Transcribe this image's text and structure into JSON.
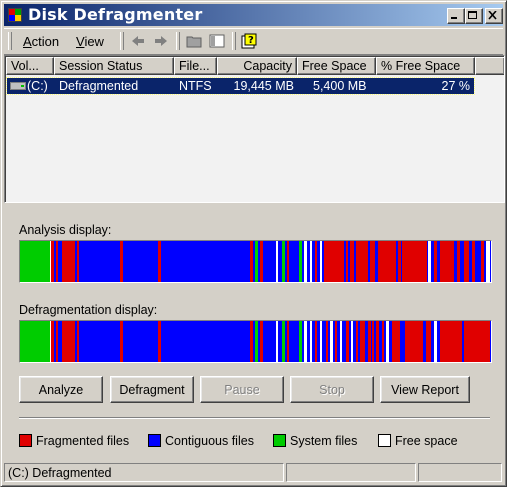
{
  "window": {
    "title": "Disk Defragmenter"
  },
  "menu": {
    "action": "Action",
    "view": "View"
  },
  "columns": [
    "Vol...",
    "Session Status",
    "File...",
    "Capacity",
    "Free Space",
    "% Free Space"
  ],
  "volumes": [
    {
      "volume": "(C:)",
      "status": "Defragmented",
      "filesystem": "NTFS",
      "capacity": "19,445 MB",
      "free_space": "5,400 MB",
      "percent_free": "27 %"
    }
  ],
  "analysis": {
    "label": "Analysis display:"
  },
  "defrag": {
    "label": "Defragmentation display:"
  },
  "buttons": {
    "analyze": "Analyze",
    "defragment": "Defragment",
    "pause": "Pause",
    "stop": "Stop",
    "view_report": "View Report"
  },
  "legend": [
    {
      "label": "Fragmented files",
      "color": "#e00000"
    },
    {
      "label": "Contiguous files",
      "color": "#0000ff"
    },
    {
      "label": "System files",
      "color": "#00cc00"
    },
    {
      "label": "Free space",
      "color": "#ffffff"
    }
  ],
  "status": {
    "text": "(C:) Defragmented"
  },
  "colors": {
    "titlebar_start": "#0a246a",
    "titlebar_end": "#a6caf0",
    "selection": "#0a246a"
  }
}
